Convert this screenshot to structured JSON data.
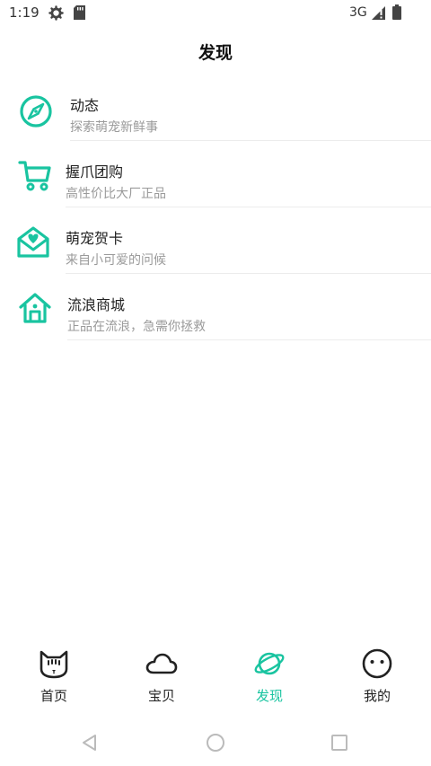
{
  "status_bar": {
    "time": "1:19",
    "network": "3G",
    "icons": [
      "settings-icon",
      "sd-card-icon",
      "signal-icon",
      "battery-icon"
    ]
  },
  "header": {
    "title": "发现"
  },
  "menu": [
    {
      "icon": "compass-icon",
      "title": "动态",
      "subtitle": "探索萌宠新鲜事"
    },
    {
      "icon": "shopping-cart-icon",
      "title": "握爪团购",
      "subtitle": "高性价比大厂正品"
    },
    {
      "icon": "greeting-card-icon",
      "title": "萌宠贺卡",
      "subtitle": "来自小可爱的问候"
    },
    {
      "icon": "shop-house-icon",
      "title": "流浪商城",
      "subtitle": "正品在流浪，急需你拯救"
    }
  ],
  "tabs": [
    {
      "icon": "cat-face-icon",
      "label": "首页",
      "active": false
    },
    {
      "icon": "cloud-icon",
      "label": "宝贝",
      "active": false
    },
    {
      "icon": "planet-icon",
      "label": "发现",
      "active": true
    },
    {
      "icon": "smiley-face-icon",
      "label": "我的",
      "active": false
    }
  ],
  "nav_bar": [
    "back-icon",
    "home-icon",
    "recents-icon"
  ],
  "colors": {
    "accent": "#19c4a0",
    "text": "#222222",
    "subtext": "#9a9a9a",
    "divider": "#ececec"
  }
}
